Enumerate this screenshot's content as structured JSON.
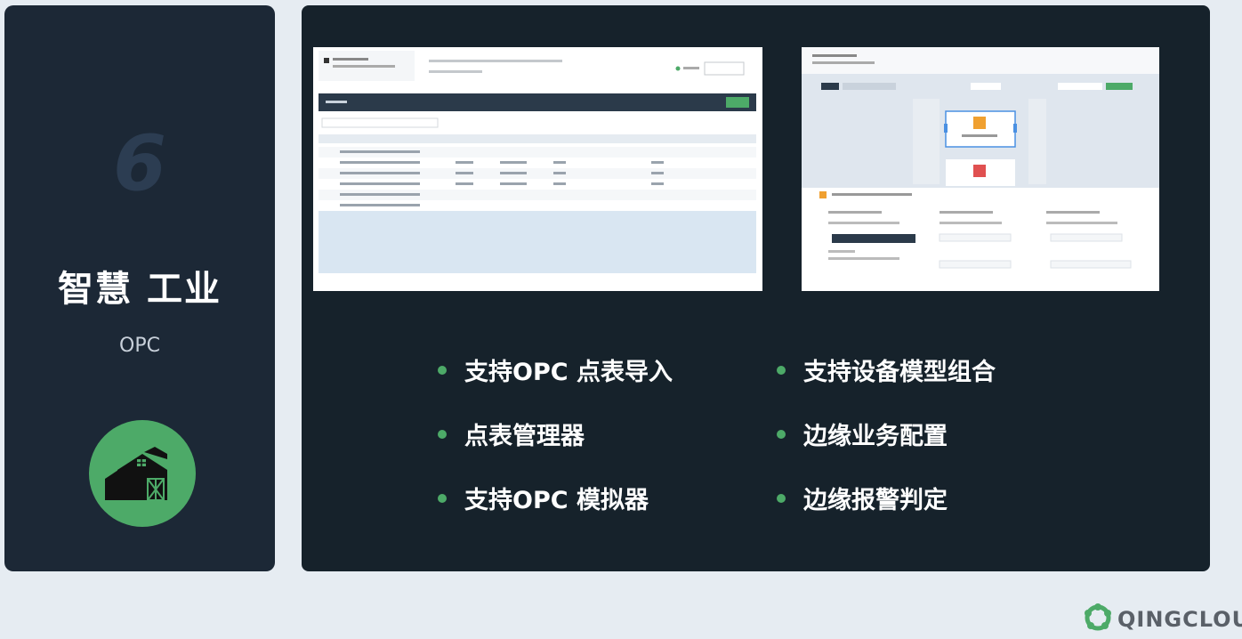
{
  "left_panel": {
    "number": "6",
    "title": "智慧 工业",
    "subtitle": "OPC",
    "icon": "barn-icon"
  },
  "right_panel": {
    "features": [
      {
        "label": "支持OPC 点表导入"
      },
      {
        "label": "支持设备模型组合"
      },
      {
        "label": "点表管理器"
      },
      {
        "label": "边缘业务配置"
      },
      {
        "label": "支持OPC 模拟器"
      },
      {
        "label": "边缘报警判定"
      }
    ],
    "screenshots": [
      "opc-table-screenshot",
      "device-model-screenshot"
    ]
  },
  "brand": {
    "logo_text": "QINGCLOUD",
    "icon": "qingcloud-logo-icon"
  },
  "colors": {
    "accent": "#4daa68",
    "left_bg": "#1c2836",
    "right_bg": "#16222b",
    "page_bg": "#e6ecf2"
  }
}
